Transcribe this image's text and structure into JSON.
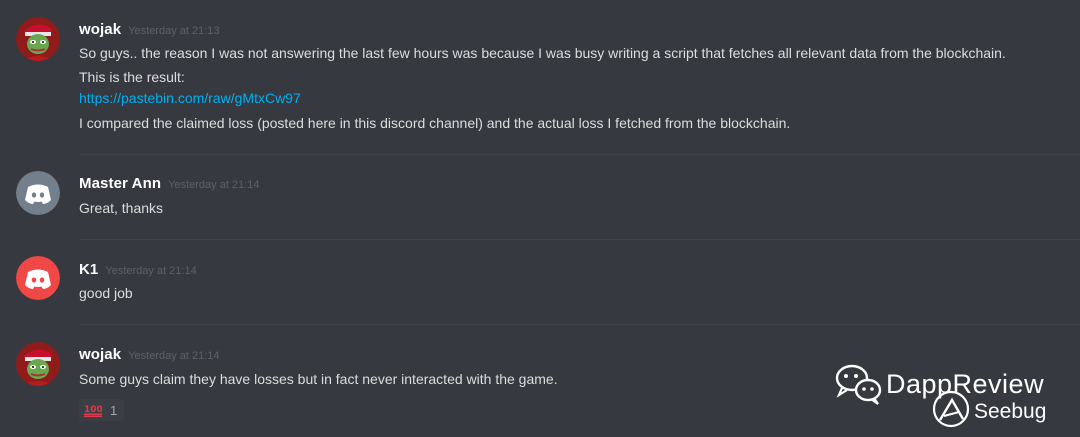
{
  "messages": [
    {
      "author": "wojak",
      "timestamp": "Yesterday at 21:13",
      "avatar_icon": "pepe-avatar-icon",
      "lines": [
        "So guys.. the reason I was not answering the last few hours was because I was busy writing a script that fetches all relevant data from the blockchain.",
        "This is the result:",
        "https://pastebin.com/raw/gMtxCw97",
        "I compared the claimed loss (posted here in this discord channel) and the actual loss I fetched from the blockchain."
      ]
    },
    {
      "author": "Master Ann",
      "timestamp": "Yesterday at 21:14",
      "avatar_icon": "discord-default-avatar-icon",
      "avatar_color": "#747f8d",
      "lines": [
        "Great, thanks"
      ]
    },
    {
      "author": "K1",
      "timestamp": "Yesterday at 21:14",
      "avatar_icon": "discord-default-avatar-icon",
      "avatar_color": "#f04747",
      "lines": [
        "good job"
      ]
    },
    {
      "author": "wojak",
      "timestamp": "Yesterday at 21:14",
      "avatar_icon": "pepe-avatar-icon",
      "lines": [
        "Some guys claim they have losses but in fact never interacted with the game."
      ],
      "reaction": {
        "emoji": "100-emoji-icon",
        "count": "1"
      }
    }
  ],
  "watermark": {
    "brand": "DappReview",
    "sub": "Seebug",
    "icon": "wechat-icon"
  },
  "colors": {
    "background": "#36393f",
    "link": "#00b0f4",
    "username": "#ffffff",
    "text": "#dcddde",
    "timestamp": "#5d6167"
  }
}
